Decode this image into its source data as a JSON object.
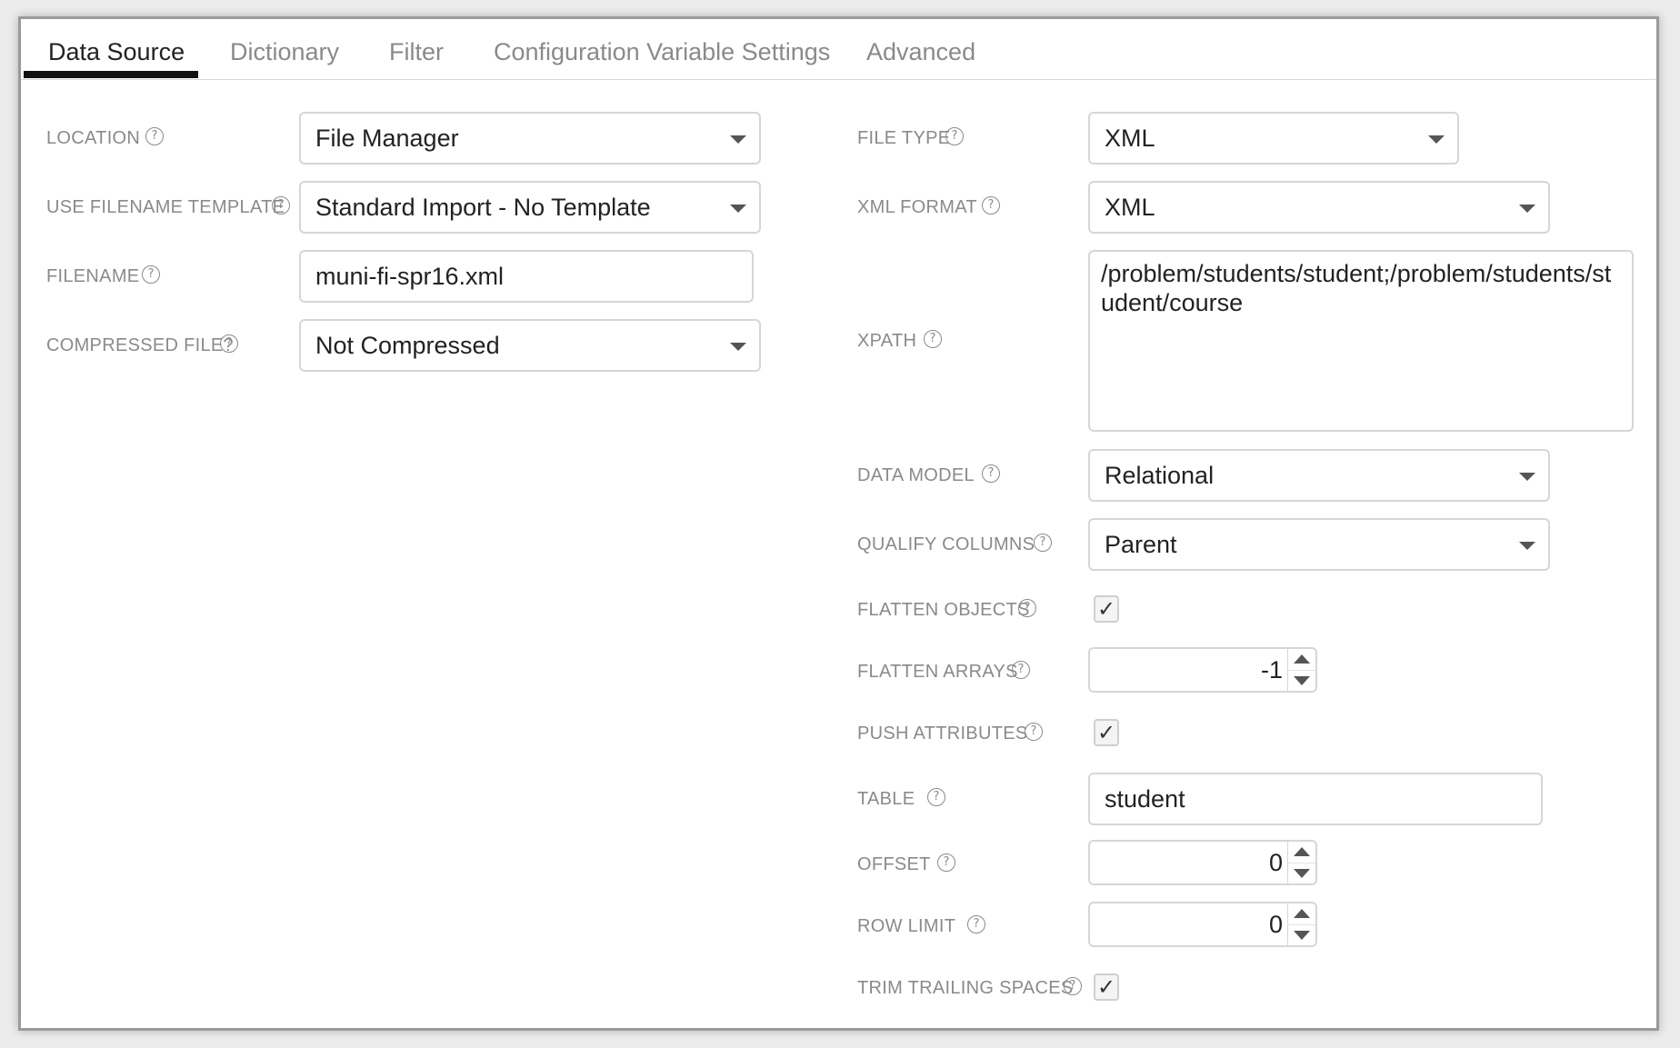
{
  "tabs": [
    "Data Source",
    "Dictionary",
    "Filter",
    "Configuration Variable Settings",
    "Advanced"
  ],
  "active_tab": "Data Source",
  "icons": {
    "help": "question-circle-icon",
    "dropdown": "caret-down-icon",
    "check": "checkmark-icon"
  },
  "help_glyph": "?",
  "check_glyph": "✓",
  "left": {
    "location": {
      "label": "LOCATION",
      "value": "File Manager"
    },
    "filename_template": {
      "label": "USE FILENAME TEMPLATE",
      "value": "Standard Import - No Template"
    },
    "filename": {
      "label": "FILENAME",
      "value": "muni-fi-spr16.xml"
    },
    "compressed": {
      "label": "COMPRESSED FILE?",
      "value": "Not Compressed"
    }
  },
  "right": {
    "file_type": {
      "label": "FILE TYPE",
      "value": "XML"
    },
    "xml_format": {
      "label": "XML FORMAT",
      "value": "XML"
    },
    "xpath": {
      "label": "XPATH",
      "value": "/problem/students/student;/problem/students/student/course"
    },
    "data_model": {
      "label": "DATA MODEL",
      "value": "Relational"
    },
    "qualify_columns": {
      "label": "QUALIFY COLUMNS",
      "value": "Parent"
    },
    "flatten_objects": {
      "label": "FLATTEN OBJECTS",
      "checked": true
    },
    "flatten_arrays": {
      "label": "FLATTEN ARRAYS",
      "value": "-1"
    },
    "push_attributes": {
      "label": "PUSH ATTRIBUTES",
      "checked": true
    },
    "table": {
      "label": "TABLE",
      "value": "student"
    },
    "offset": {
      "label": "OFFSET",
      "value": "0"
    },
    "row_limit": {
      "label": "ROW LIMIT",
      "value": "0"
    },
    "trim_trailing_spaces": {
      "label": "TRIM TRAILING SPACES",
      "checked": true
    }
  }
}
